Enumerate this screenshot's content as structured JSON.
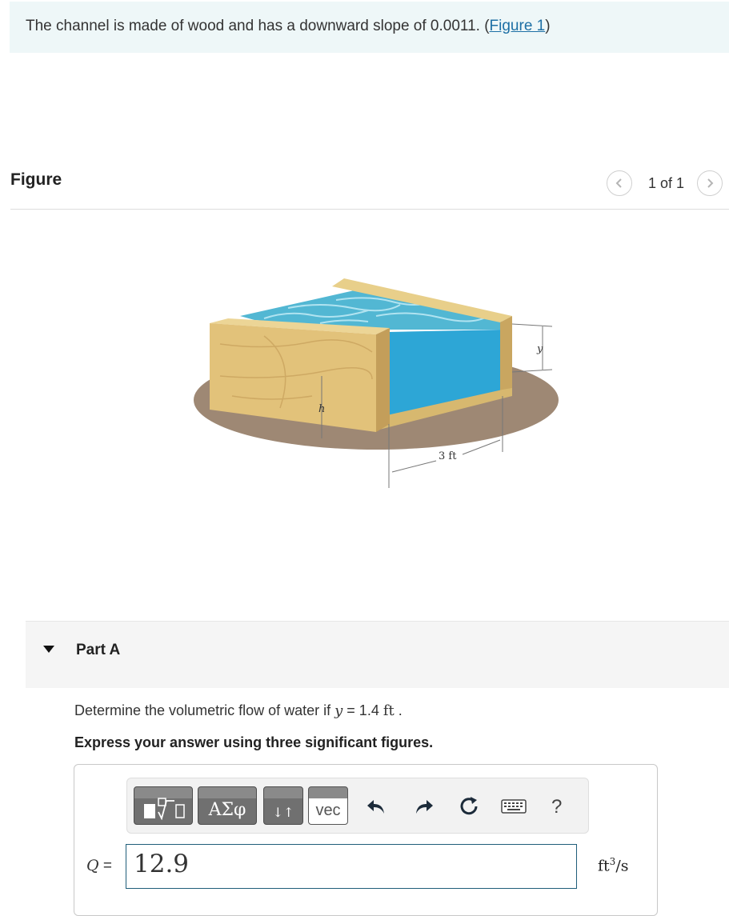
{
  "problem": {
    "statement": "The channel is made of wood and has a downward slope of 0.0011.",
    "figure_link_open": " (",
    "figure_link": "Figure 1",
    "figure_link_close": ")"
  },
  "figure": {
    "heading": "Figure",
    "pager_count": "1 of 1",
    "prev_icon": "chevron-left-icon",
    "next_icon": "chevron-right-icon",
    "labels": {
      "h": "h",
      "y": "y",
      "width": "3 ft"
    }
  },
  "part": {
    "label": "Part A",
    "toggle_icon": "caret-down-icon"
  },
  "question": {
    "prefix": "Determine the volumetric flow of water if ",
    "variable": "y",
    "equals": " = 1.4 ",
    "unit": "ft",
    "suffix": " ."
  },
  "instruction": "Express your answer using three significant figures.",
  "toolbar": {
    "template_icon": "fraction-radical-template-icon",
    "greek_label": "ΑΣφ",
    "arrows_label": "↓↑",
    "vec_label": "vec",
    "undo_icon": "undo-icon",
    "redo_icon": "redo-icon",
    "reset_icon": "reset-icon",
    "keyboard_icon": "keyboard-icon",
    "help_label": "?"
  },
  "answer": {
    "variable": "Q",
    "equals": " =",
    "value": "12.9",
    "unit_base": "ft",
    "unit_exp": "3",
    "unit_tail": "/s"
  }
}
